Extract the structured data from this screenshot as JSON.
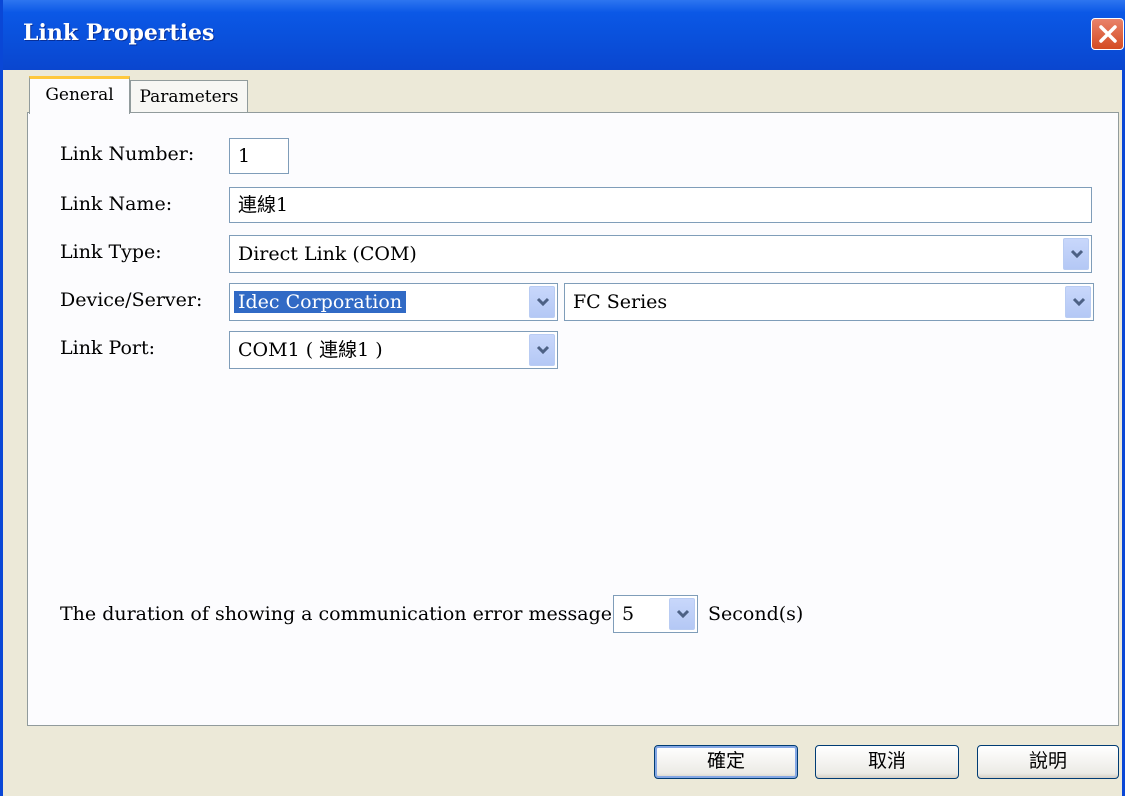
{
  "window": {
    "title": "Link Properties"
  },
  "tabs": [
    {
      "label": "General",
      "active": true
    },
    {
      "label": "Parameters",
      "active": false
    }
  ],
  "general": {
    "link_number": {
      "label": "Link Number:",
      "value": "1"
    },
    "link_name": {
      "label": "Link Name:",
      "value": "連線1"
    },
    "link_type": {
      "label": "Link Type:",
      "value": "Direct Link (COM)"
    },
    "device_server": {
      "label": "Device/Server:",
      "manufacturer": "Idec Corporation",
      "series": "FC Series"
    },
    "link_port": {
      "label": "Link Port:",
      "value": "COM1 ( 連線1 )"
    },
    "error_duration": {
      "label": "The duration of showing a communication error message:",
      "value": "5",
      "unit": "Second(s)"
    }
  },
  "buttons": {
    "ok": "確定",
    "cancel": "取消",
    "help": "說明"
  },
  "colors": {
    "titlebar": "#0a4fda",
    "dialog_bg": "#ece9d8",
    "selection": "#316ac5",
    "close_button": "#d44b22"
  }
}
